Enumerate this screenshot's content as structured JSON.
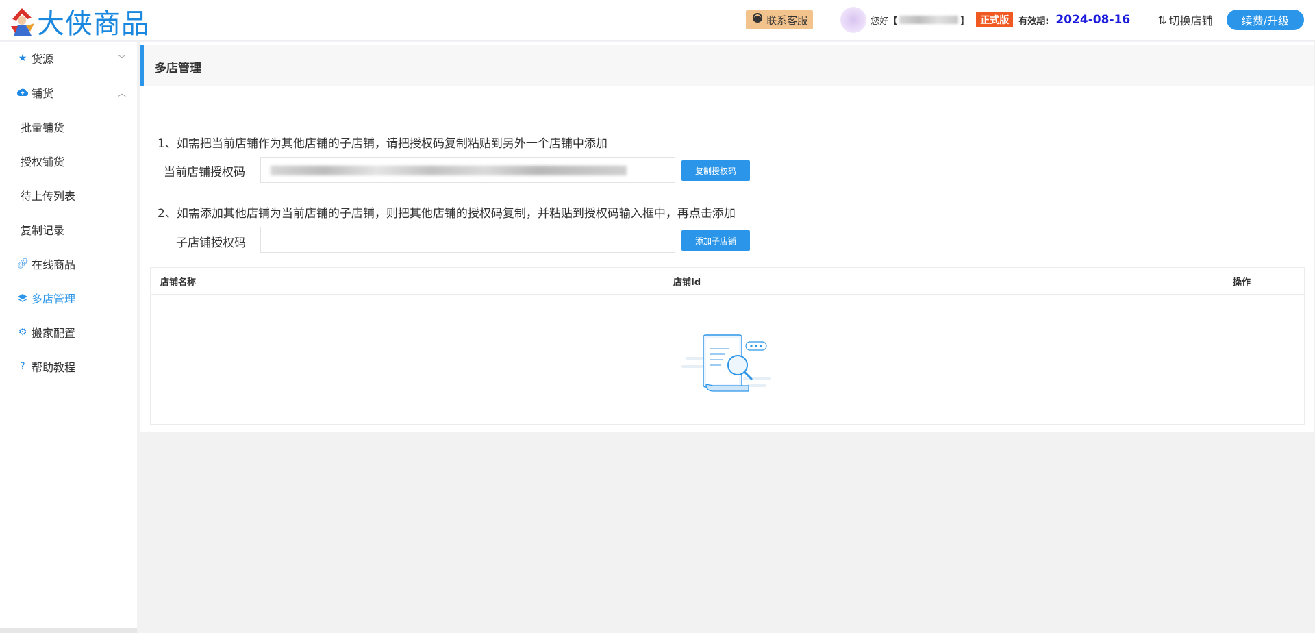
{
  "header": {
    "logo_text": "大侠商品",
    "support_label": "联系客服",
    "hello_prefix": "您好【",
    "hello_suffix": "】",
    "badge": "正式版",
    "valid_label": "有效期:",
    "valid_date": "2024-08-16",
    "switch_shop_label": "切换店铺",
    "upgrade_label": "续费/升级"
  },
  "sidebar": {
    "items": [
      {
        "label": "货源",
        "icon": "star-icon"
      },
      {
        "label": "铺货",
        "icon": "cloud-upload-icon"
      },
      {
        "label": "批量铺货"
      },
      {
        "label": "授权铺货"
      },
      {
        "label": "待上传列表"
      },
      {
        "label": "复制记录"
      },
      {
        "label": "在线商品",
        "icon": "link-icon"
      },
      {
        "label": "多店管理",
        "icon": "layers-icon"
      },
      {
        "label": "搬家配置",
        "icon": "gear-icon"
      },
      {
        "label": "帮助教程",
        "icon": "question-icon"
      }
    ],
    "active": "多店管理"
  },
  "page": {
    "title": "多店管理",
    "step1": "1、如需把当前店铺作为其他店铺的子店铺，请把授权码复制粘贴到另外一个店铺中添加",
    "current_code_label": "当前店铺授权码",
    "copy_btn": "复制授权码",
    "step2": "2、如需添加其他店铺为当前店铺的子店铺，则把其他店铺的授权码复制，并粘贴到授权码输入框中，再点击添加",
    "child_code_label": "子店铺授权码",
    "child_code_placeholder": "",
    "add_btn": "添加子店铺"
  },
  "table": {
    "columns": [
      "店铺名称",
      "店铺Id",
      "操作"
    ],
    "rows": []
  },
  "colors": {
    "accent": "#2b96e9",
    "badge": "#f05a22",
    "date": "#1a1adc",
    "support_bg": "#f3c38e"
  }
}
